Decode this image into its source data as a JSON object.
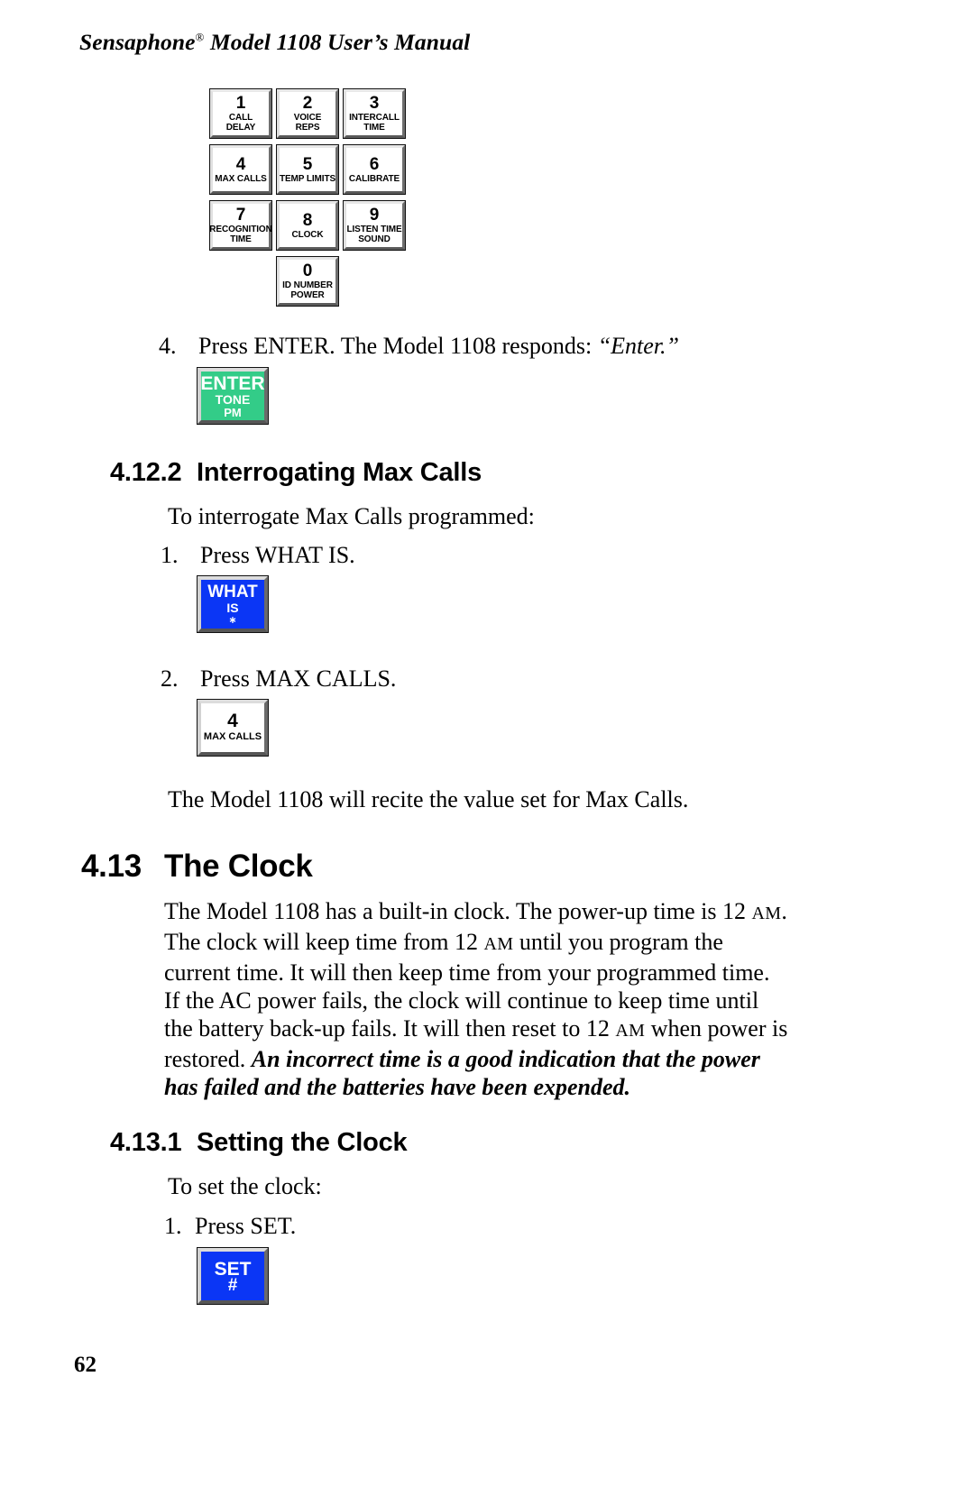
{
  "header": {
    "title_prefix": "Sensaphone",
    "registered_mark": "®",
    "title_suffix": " Model 1108 User’s Manual"
  },
  "keypad": {
    "name": "sensaphone-keypad-diagram",
    "keys": [
      {
        "digit": "1",
        "line1": "CALL",
        "line2": "DELAY"
      },
      {
        "digit": "2",
        "line1": "VOICE",
        "line2": "REPS"
      },
      {
        "digit": "3",
        "line1": "INTERCALL",
        "line2": "TIME"
      },
      {
        "digit": "4",
        "line1": "MAX CALLS",
        "line2": ""
      },
      {
        "digit": "5",
        "line1": "TEMP LIMITS",
        "line2": ""
      },
      {
        "digit": "6",
        "line1": "CALIBRATE",
        "line2": ""
      },
      {
        "digit": "7",
        "line1": "RECOGNITION",
        "line2": "TIME"
      },
      {
        "digit": "8",
        "line1": "CLOCK",
        "line2": ""
      },
      {
        "digit": "9",
        "line1": "LISTEN TIME",
        "line2": "SOUND"
      },
      {
        "digit": "0",
        "line1": "ID NUMBER",
        "line2": "POWER"
      }
    ]
  },
  "step_enter": {
    "number": "4.",
    "text_plain": "Press ENTER. The Model 1108 responds: ",
    "text_quote": "“Enter.”"
  },
  "enter_key": {
    "name": "enter-key",
    "t1": "ENTER",
    "t2": "TONE",
    "t3": "PM",
    "color": "#33cc88"
  },
  "section_4122": {
    "number": "4.12.2",
    "title": "Interrogating Max Calls",
    "intro": "To interrogate Max Calls programmed:",
    "step1_num": "1.",
    "step1_text": "Press WHAT IS.",
    "step2_num": "2.",
    "step2_text": "Press MAX CALLS.",
    "closing": "The Model 1108 will recite the value set for Max Calls."
  },
  "whatis_key": {
    "name": "what-is-key",
    "t1": "WHAT",
    "t2": "IS",
    "t3": "∗",
    "color": "#0b36f5"
  },
  "maxcalls_key": {
    "name": "max-calls-key",
    "digit": "4",
    "label": "MAX CALLS"
  },
  "section_413": {
    "number": "4.13",
    "title": "The Clock",
    "paragraph_lines": [
      {
        "parts": [
          {
            "t": "The Model 1108 has a built-in clock. The power-up time is 12 ",
            "s": "normal"
          },
          {
            "t": "AM",
            "s": "smallcaps"
          },
          {
            "t": ".",
            "s": "normal"
          }
        ]
      },
      {
        "parts": [
          {
            "t": "The clock will keep time from 12 ",
            "s": "normal"
          },
          {
            "t": "AM",
            "s": "smallcaps"
          },
          {
            "t": " until you program the",
            "s": "normal"
          }
        ]
      },
      {
        "parts": [
          {
            "t": "current time. It will then keep time from your programmed time.",
            "s": "normal"
          }
        ]
      },
      {
        "parts": [
          {
            "t": "If the AC power fails, the clock will continue to keep time until",
            "s": "normal"
          }
        ]
      },
      {
        "parts": [
          {
            "t": "the battery back-up fails. It will then reset to 12 ",
            "s": "normal"
          },
          {
            "t": "AM",
            "s": "smallcaps"
          },
          {
            "t": " when power is",
            "s": "normal"
          }
        ]
      },
      {
        "parts": [
          {
            "t": "restored. ",
            "s": "normal"
          },
          {
            "t": "An incorrect time is a good indication that the power",
            "s": "bolditalic"
          }
        ]
      },
      {
        "parts": [
          {
            "t": "has failed and the batteries have been expended.",
            "s": "bolditalic"
          }
        ]
      }
    ]
  },
  "section_4131": {
    "number": "4.13.1",
    "title": "Setting the Clock",
    "intro": "To set the clock:",
    "step1_num": "1.",
    "step1_text": "Press SET."
  },
  "set_key": {
    "name": "set-key",
    "t1": "SET",
    "t2": "#",
    "color": "#0b36f5"
  },
  "footer": {
    "page_number": "62"
  }
}
